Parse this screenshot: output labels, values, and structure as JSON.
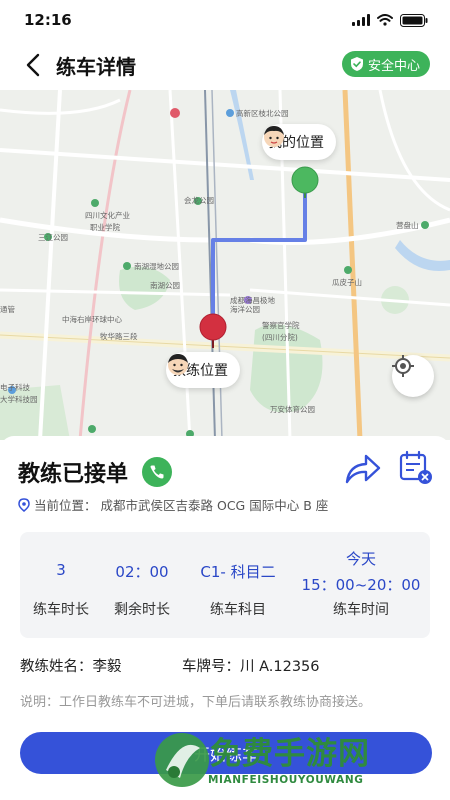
{
  "status_bar": {
    "time": "12:16"
  },
  "header": {
    "title": "练车详情",
    "safety_label": "安全中心"
  },
  "map": {
    "labels": {
      "my_location": "我的位置",
      "coach_location": "教练位置",
      "pois": [
        "高新区枝北公园",
        "四川文化产业职业学院",
        "三江公园",
        "南湖湿地公园",
        "南湖公园",
        "会龙公园",
        "中海右岸环球中心",
        "牧华路三段",
        "成都海昌极地海洋公园",
        "警察官学院(四川分院)",
        "万安体育公园",
        "瓜皮子山",
        "普德高速",
        "营盘山",
        "电子科技大学科技园",
        "通管"
      ]
    }
  },
  "order": {
    "status_title": "教练已接单",
    "location_prefix": "当前位置：",
    "location_value": "成都市武侯区吉泰路 OCG 国际中心 B 座",
    "stats": [
      {
        "value": "3",
        "label": "练车时长"
      },
      {
        "value": "02：00",
        "label": "剩余时长"
      },
      {
        "value": "C1- 科目二",
        "label": "练车科目"
      },
      {
        "value_line1": "今天",
        "value_line2": "15：00~20：00",
        "label": "练车时间"
      }
    ],
    "coach_name_label": "教练姓名：",
    "coach_name": "李毅",
    "plate_label": "车牌号：",
    "plate": "川 A.12356",
    "note": "说明：工作日教练车不可进城，下单后请联系教练协商接送。",
    "start_button": "开始练车"
  },
  "watermark": {
    "main": "免费手游网",
    "sub": "MIANFEISHOUYOUWANG"
  },
  "colors": {
    "green": "#3db35a",
    "blue": "#3552d9",
    "route": "#6680e6",
    "coach_pin": "#d33040",
    "me_pin": "#4cb860"
  }
}
